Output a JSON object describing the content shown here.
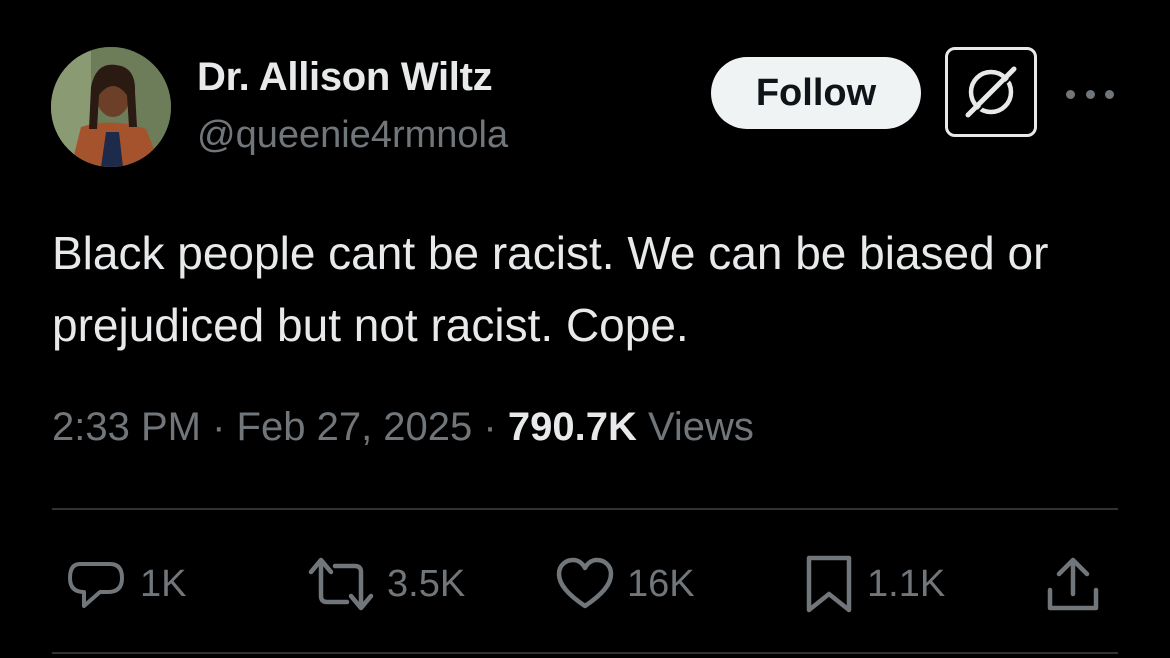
{
  "author": {
    "name": "Dr. Allison Wiltz",
    "handle": "@queenie4rmnola"
  },
  "header": {
    "follow_label": "Follow",
    "grok_icon": "grok-icon",
    "more_icon": "more-icon"
  },
  "tweet": {
    "text": "Black people cant be racist. We can be biased or prejudiced but not racist. Cope.",
    "time": "2:33 PM",
    "date": "Feb 27, 2025",
    "views_count": "790.7K",
    "views_label": "Views"
  },
  "actions": {
    "reply": {
      "icon": "reply-icon",
      "count": "1K"
    },
    "repost": {
      "icon": "repost-icon",
      "count": "3.5K"
    },
    "like": {
      "icon": "heart-icon",
      "count": "16K"
    },
    "bookmark": {
      "icon": "bookmark-icon",
      "count": "1.1K"
    },
    "share": {
      "icon": "share-icon"
    }
  },
  "colors": {
    "background": "#000000",
    "text_primary": "#e7e9ea",
    "text_secondary": "#71767b",
    "follow_bg": "#eff3f4",
    "divider": "#2f3336"
  }
}
